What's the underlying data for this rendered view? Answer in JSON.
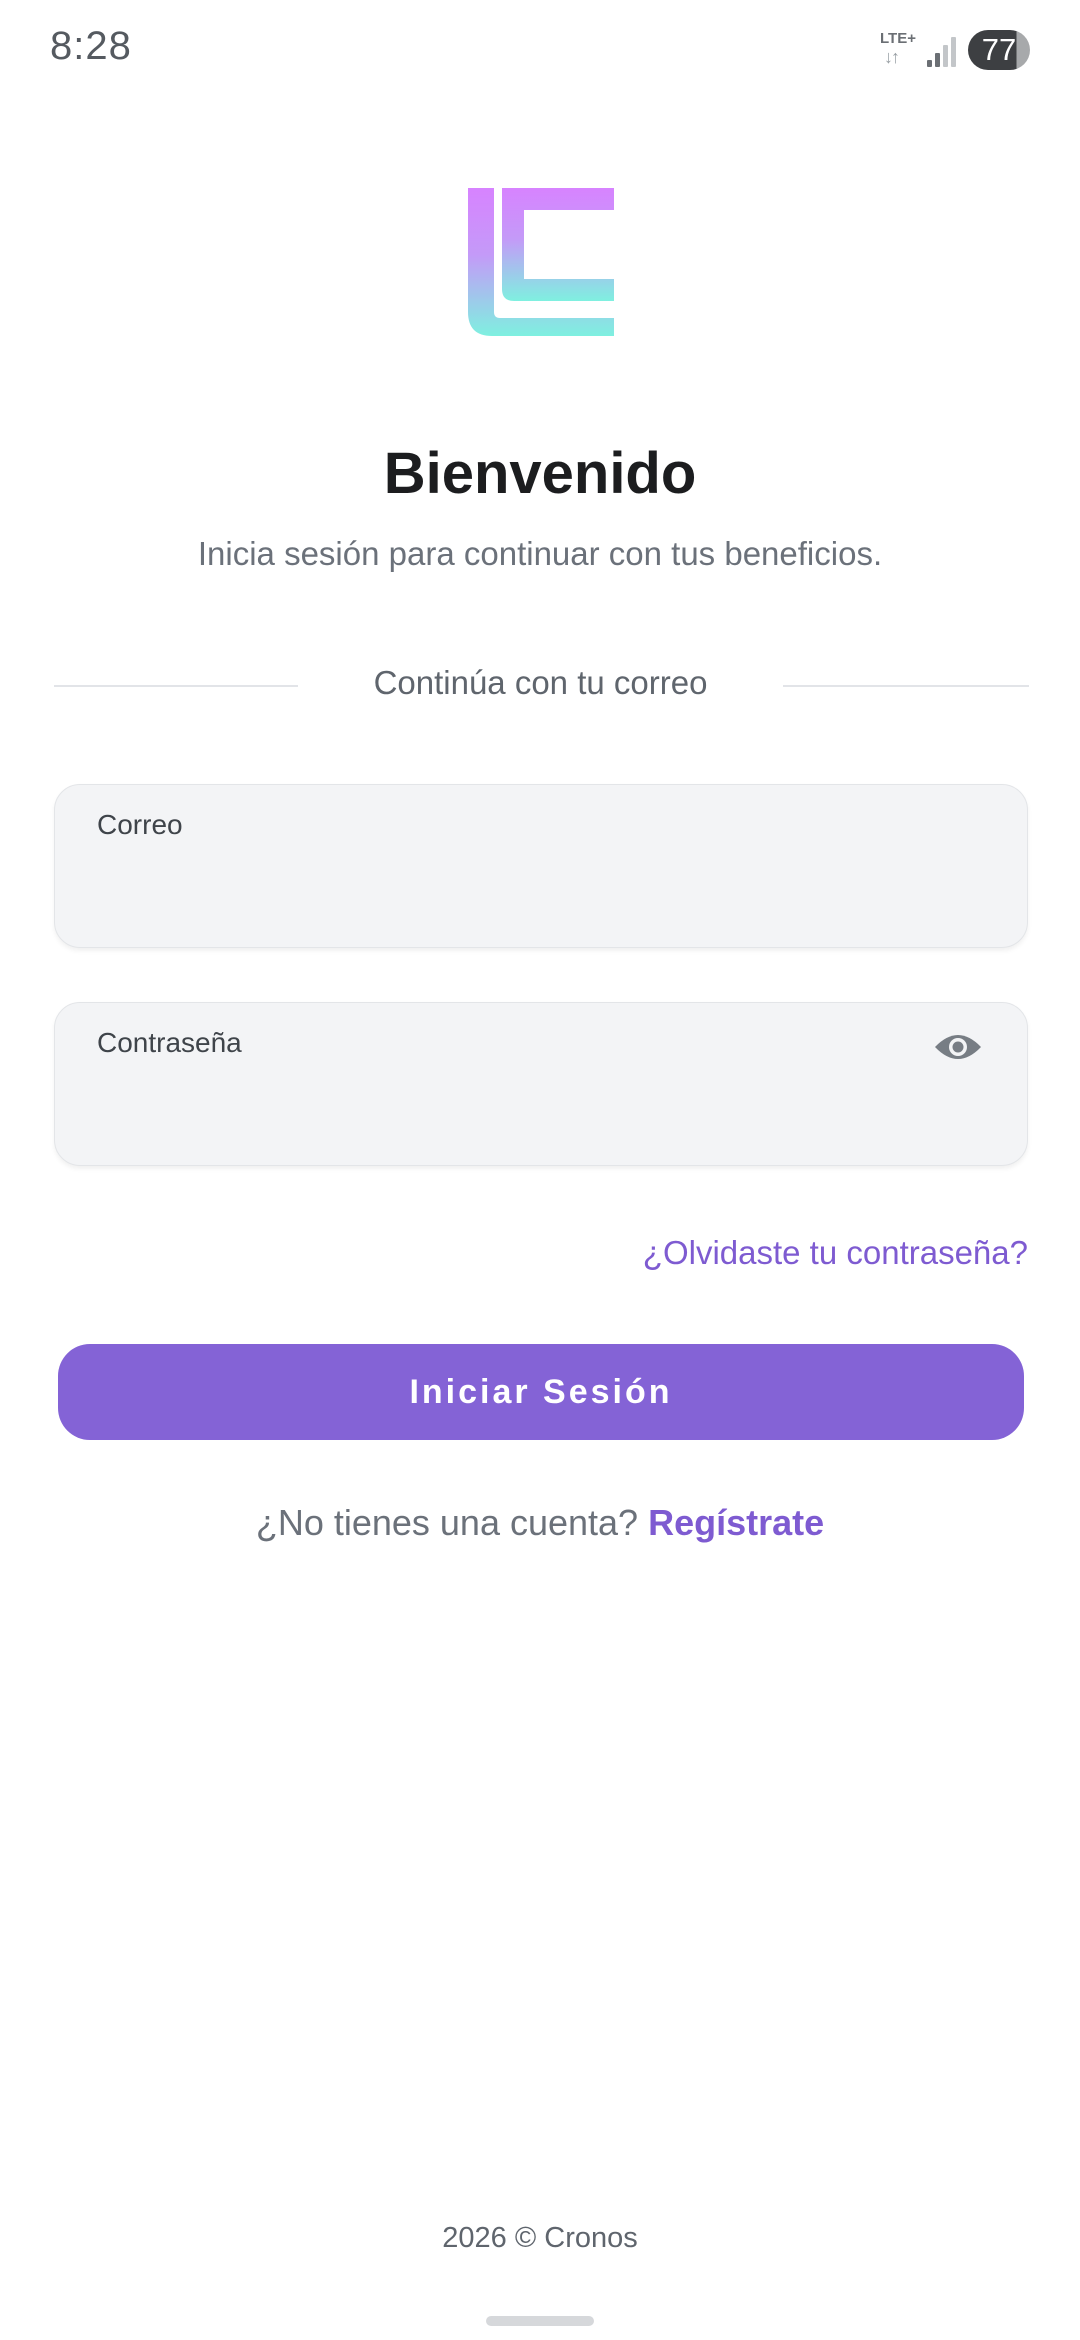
{
  "status_bar": {
    "time": "8:28",
    "network": "LTE+",
    "network_arrows": "↓↑",
    "battery": "77",
    "icons": [
      "signal-icon",
      "battery-icon"
    ]
  },
  "header": {
    "logo": "lc-logo",
    "title": "Bienvenido",
    "subtitle": "Inicia sesión para continuar con tus beneficios."
  },
  "divider": {
    "text": "Continúa con tu correo"
  },
  "form": {
    "email": {
      "label": "Correo",
      "value": ""
    },
    "password": {
      "label": "Contraseña",
      "value": "",
      "toggle_icon": "eye-icon"
    },
    "forgot_link": "¿Olvidaste tu contraseña?",
    "submit_label": "Iniciar Sesión"
  },
  "signup": {
    "prompt": "¿No tienes una cuenta?",
    "link": "Regístrate"
  },
  "footer": {
    "text": "2026 © Cronos"
  },
  "colors": {
    "accent": "#8463d6",
    "link": "#7e5bd1",
    "logo_gradient_top": "#d783ff",
    "logo_gradient_bottom": "#7ff0e0",
    "field_background": "#f3f4f6"
  }
}
